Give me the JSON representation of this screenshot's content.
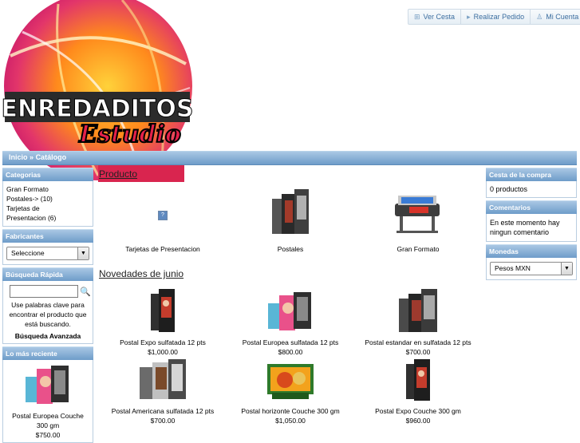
{
  "logo": {
    "line1": "ENREDADITOS",
    "line2": "Estudio"
  },
  "header_buttons": [
    {
      "label": "Ver Cesta",
      "icon": "cart-icon"
    },
    {
      "label": "Realizar Pedido",
      "icon": "arrow-right-icon"
    },
    {
      "label": "Mi Cuenta",
      "icon": "user-icon"
    }
  ],
  "breadcrumb": {
    "home": "Inicio",
    "sep": "»",
    "current": "Catálogo"
  },
  "left": {
    "categories": {
      "title": "Categorias",
      "items": [
        "Gran Formato",
        "Postales-> (10)",
        "Tarjetas de Presentacion (6)"
      ]
    },
    "manufacturers": {
      "title": "Fabricantes",
      "selected": "Seleccione"
    },
    "quick_search": {
      "title": "Búsqueda Rápida",
      "help": "Use palabras clave para encontrar el producto que está buscando.",
      "advanced": "Búsqueda Avanzada"
    },
    "latest": {
      "title": "Lo más reciente",
      "product": "Postal Europea Couche 300 gm",
      "price": "$750.00"
    }
  },
  "right": {
    "cart": {
      "title": "Cesta de la compra",
      "text": "0 productos"
    },
    "reviews": {
      "title": "Comentarios",
      "text": "En este momento hay ningun comentario"
    },
    "currency": {
      "title": "Monedas",
      "selected": "Pesos MXN"
    }
  },
  "main": {
    "products_title": "Producto",
    "categories": [
      {
        "name": "Tarjetas de Presentacion"
      },
      {
        "name": "Postales"
      },
      {
        "name": "Gran Formato"
      }
    ],
    "news_title": "Novedades de junio",
    "new_products": [
      {
        "name": "Postal Expo sulfatada 12 pts",
        "price": "$1,000.00"
      },
      {
        "name": "Postal Europea sulfatada 12 pts",
        "price": "$800.00"
      },
      {
        "name": "Postal estandar en sulfatada 12 pts",
        "price": "$700.00"
      },
      {
        "name": "Postal Americana sulfatada 12 pts",
        "price": "$700.00"
      },
      {
        "name": "Postal horizonte Couche 300 gm",
        "price": "$1,050.00"
      },
      {
        "name": "Postal Expo Couche 300 gm",
        "price": "$960.00"
      }
    ]
  },
  "colors": {
    "bar_top": "#a9c7e4",
    "bar_bottom": "#6e9cc9",
    "link": "#3d6fa0"
  }
}
